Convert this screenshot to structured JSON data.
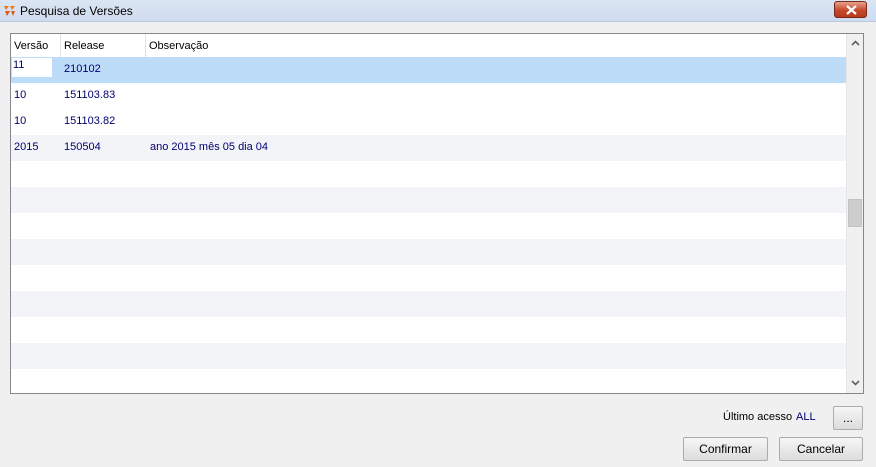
{
  "window": {
    "title": "Pesquisa de Versões",
    "icon": "app-logo-icon",
    "close_icon": "close-icon"
  },
  "grid": {
    "columns": [
      "Versão",
      "Release",
      "Observação"
    ],
    "rows": [
      {
        "versao": "11",
        "release": "210102",
        "observacao": "",
        "selected": true
      },
      {
        "versao": "10",
        "release": "151103.83",
        "observacao": ""
      },
      {
        "versao": "10",
        "release": "151103.82",
        "observacao": ""
      },
      {
        "versao": "2015",
        "release": "150504",
        "observacao": "ano 2015 mês 05 dia 04"
      }
    ],
    "colors": {
      "selected_row": "#bcdcf7",
      "alt_row": "#f2f4f8",
      "cell_text": "#00006e"
    }
  },
  "footer": {
    "last_access_label": "Último acesso",
    "last_access_value": "ALL",
    "more_button": "...",
    "confirm_button": "Confirmar",
    "cancel_button": "Cancelar"
  }
}
